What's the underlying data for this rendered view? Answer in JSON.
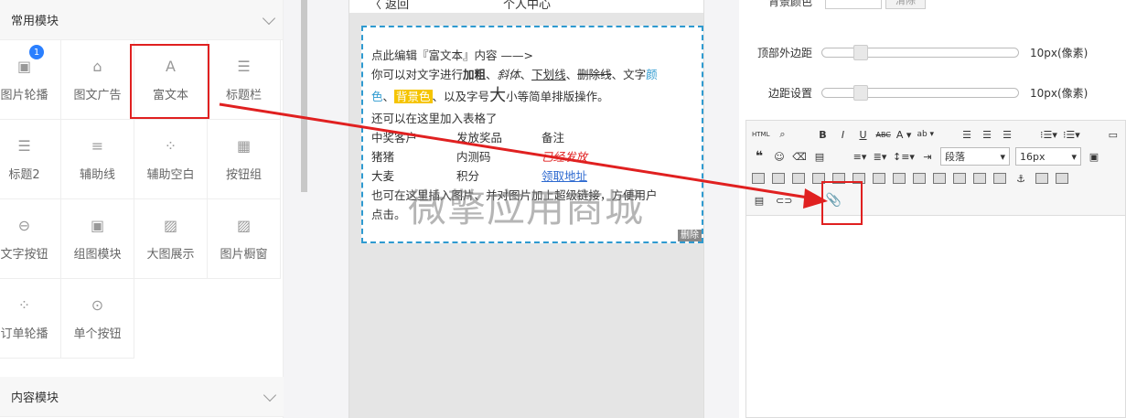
{
  "left_panel": {
    "section1_title": "常用模块",
    "section2_title": "内容模块",
    "modules": [
      {
        "label": "图片轮播",
        "icon": "image-carousel-icon",
        "glyph": "▣",
        "badge": "1"
      },
      {
        "label": "图文广告",
        "icon": "image-ad-icon",
        "glyph": "⌂"
      },
      {
        "label": "富文本",
        "icon": "rich-text-icon",
        "glyph": "A"
      },
      {
        "label": "标题栏",
        "icon": "title-bar-icon",
        "glyph": "☰"
      },
      {
        "label": "标题2",
        "icon": "title2-icon",
        "glyph": "☰"
      },
      {
        "label": "辅助线",
        "icon": "divider-line-icon",
        "glyph": "≡"
      },
      {
        "label": "辅助空白",
        "icon": "blank-space-icon",
        "glyph": "⁘"
      },
      {
        "label": "按钮组",
        "icon": "button-group-icon",
        "glyph": "▦"
      },
      {
        "label": "文字按钮",
        "icon": "text-button-icon",
        "glyph": "⊖"
      },
      {
        "label": "组图模块",
        "icon": "image-group-icon",
        "glyph": "▣"
      },
      {
        "label": "大图展示",
        "icon": "large-image-icon",
        "glyph": "▨"
      },
      {
        "label": "图片橱窗",
        "icon": "image-window-icon",
        "glyph": "▨"
      },
      {
        "label": "订单轮播",
        "icon": "order-carousel-icon",
        "glyph": "⁘"
      },
      {
        "label": "单个按钮",
        "icon": "single-button-icon",
        "glyph": "⊙"
      }
    ]
  },
  "phone": {
    "back_label": "〈 返回",
    "title": "个人中心",
    "menu": "•••",
    "rich": {
      "line1": "点此编辑『富文本』内容 ——>",
      "l2a": "你可以对文字进行",
      "l2_bold": "加粗",
      "l2_sep1": "、",
      "l2_italic": "斜体",
      "l2_sep2": "、",
      "l2_underline": "下划线",
      "l2_sep3": "、",
      "l2_strike": "删除线",
      "l2_sep4": "、文字",
      "l2_color": "颜",
      "l3_color": "色",
      "l3_sep1": "、",
      "l3_bg": "背景色",
      "l3_sep2": "、以及字号",
      "l3_big": "大",
      "l3_end": "小等简单排版操作。",
      "line4": "还可以在这里加入表格了",
      "table": [
        [
          "中奖客户",
          "发放奖品",
          "备注"
        ],
        [
          "猪猪",
          "内测码",
          "已经发放"
        ],
        [
          "大麦",
          "积分",
          "领取地址"
        ]
      ],
      "line5": "也可在这里插入图片、并对图片加上超级链接，方便用户",
      "line6": "点击。",
      "delete": "删除"
    }
  },
  "settings": {
    "top_label": "背景颜色",
    "clear": "清除",
    "margin_top_label": "顶部外边距",
    "margin_top_value": "10px(像素)",
    "margin_top_level": 0.2,
    "padding_label": "边距设置",
    "padding_value": "10px(像素)",
    "padding_level": 0.2
  },
  "editor": {
    "paragraph": "段落",
    "font_size": "16px"
  },
  "watermark": "微擎应用商城",
  "colors": {
    "accent": "#2e9ad0",
    "highlight": "#e02020",
    "badge": "#2a7fff"
  }
}
